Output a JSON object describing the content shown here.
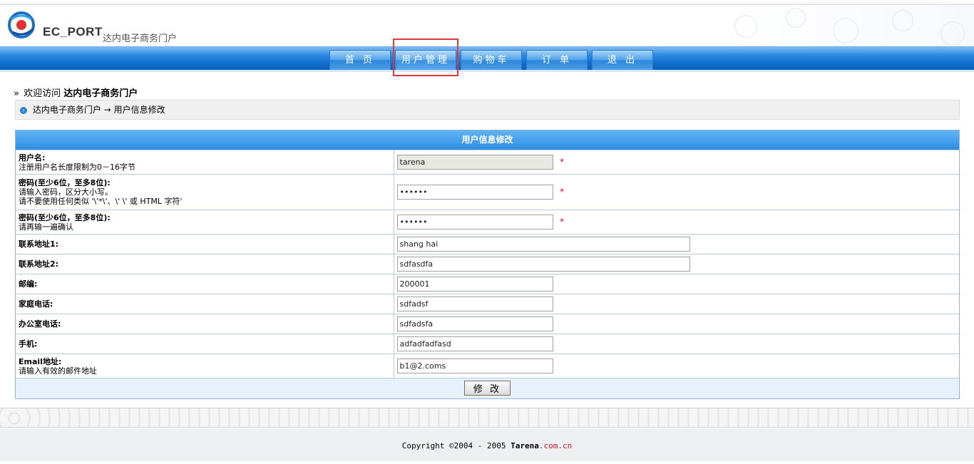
{
  "header": {
    "brand": "EC_PORT",
    "subtitle": "达内电子商务门户"
  },
  "nav": {
    "items": [
      {
        "label": "首 页"
      },
      {
        "label": "用户管理"
      },
      {
        "label": "购物车"
      },
      {
        "label": "订 单"
      },
      {
        "label": "退 出"
      }
    ],
    "active_index": 1
  },
  "welcome": {
    "prefix": "欢迎访问",
    "site": "达内电子商务门户"
  },
  "breadcrumb": {
    "home": "达内电子商务门户",
    "separator": "→",
    "current": "用户信息修改"
  },
  "form": {
    "title": "用户信息修改",
    "rows": [
      {
        "label": "用户名:",
        "hint": "注册用户名长度限制为0－16字节",
        "value": "tarena",
        "required": true
      },
      {
        "label": "密码(至少6位，至多8位):",
        "hint": "请输入密码，区分大小写。",
        "hint2": "请不要使用任何类似 '\\'*\\'、\\' \\' 或 HTML 字符'",
        "value": "••••••",
        "required": true
      },
      {
        "label": "密码(至少6位，至多8位):",
        "hint": "请再输一遍确认",
        "value": "••••••",
        "required": true
      },
      {
        "label": "联系地址1:",
        "value": "shang hai"
      },
      {
        "label": "联系地址2:",
        "value": "sdfasdfa"
      },
      {
        "label": "邮编:",
        "value": "200001"
      },
      {
        "label": "家庭电话:",
        "value": "sdfadsf"
      },
      {
        "label": "办公室电话:",
        "value": "sdfadsfa"
      },
      {
        "label": "手机:",
        "value": "adfadfadfasd"
      },
      {
        "label": "Email地址:",
        "hint": "请输入有效的邮件地址",
        "value": "b1@2.coms"
      }
    ],
    "required_mark": "*",
    "submit_label": "修 改"
  },
  "footer": {
    "prefix": "Copyright ©2004 - 2005 ",
    "company": "Tarena",
    "domain": ".com.cn"
  },
  "colors": {
    "nav_blue": "#0f6dcc",
    "title_blue": "#2f8ee3",
    "required_red": "#d01010",
    "highlight_red": "#e23a3a"
  }
}
